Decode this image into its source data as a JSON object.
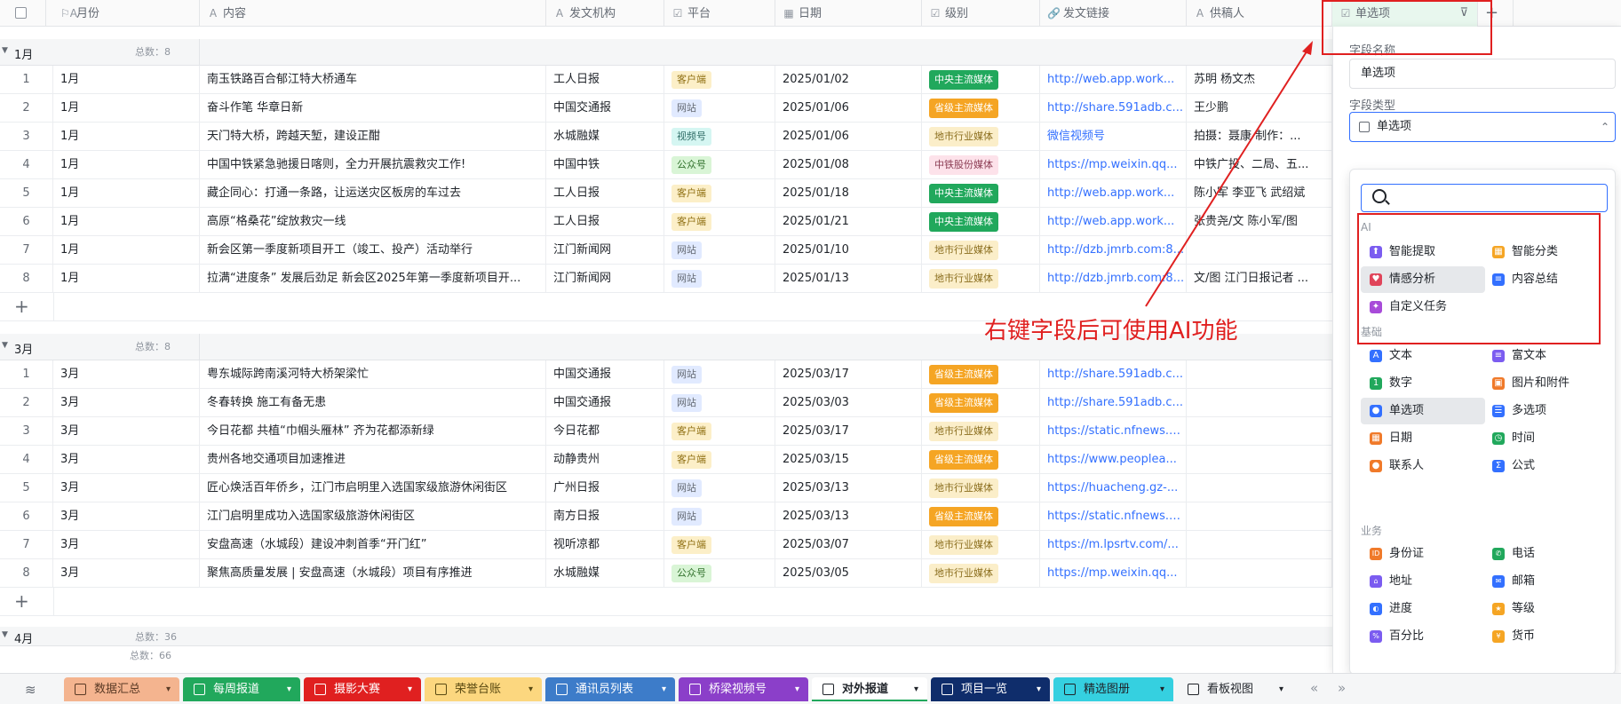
{
  "header": {
    "columns": [
      "月份",
      "内容",
      "发文机构",
      "平台",
      "日期",
      "级别",
      "发文链接",
      "供稿人",
      "单选项"
    ],
    "add": "+"
  },
  "groups": [
    {
      "name": "1月",
      "count": "总数：8",
      "rows": [
        [
          "1",
          "1月",
          "南玉铁路百合郁江特大桥通车",
          "工人日报",
          "客户端",
          "2025/01/02",
          "中央主流媒体",
          "http://web.app.work...",
          "苏明 杨文杰"
        ],
        [
          "2",
          "1月",
          "奋斗作笔 华章日新",
          "中国交通报",
          "网站",
          "2025/01/06",
          "省级主流媒体",
          "http://share.591adb.c...",
          "王少鹏"
        ],
        [
          "3",
          "1月",
          "天门特大桥，跨越天堑，建设正酣",
          "水城融媒",
          "视频号",
          "2025/01/06",
          "地市行业媒体",
          "微信视频号",
          "拍摄：聂康    制作：..."
        ],
        [
          "4",
          "1月",
          "中国中铁紧急驰援日喀则，全力开展抗震救灾工作!",
          "中国中铁",
          "公众号",
          "2025/01/08",
          "中铁股份媒体",
          "https://mp.weixin.qq...",
          "中铁广投、二局、五..."
        ],
        [
          "5",
          "1月",
          "藏企同心：打通一条路，让运送灾区板房的车过去",
          "工人日报",
          "客户端",
          "2025/01/18",
          "中央主流媒体",
          "http://web.app.work...",
          "陈小军 李亚飞 武绍斌"
        ],
        [
          "6",
          "1月",
          "高原“格桑花”绽放救灾一线",
          "工人日报",
          "客户端",
          "2025/01/21",
          "中央主流媒体",
          "http://web.app.work...",
          "张贵尧/文 陈小军/图"
        ],
        [
          "7",
          "1月",
          "新会区第一季度新项目开工（竣工、投产）活动举行",
          "江门新闻网",
          "网站",
          "2025/01/10",
          "地市行业媒体",
          "http://dzb.jmrb.com:8...",
          ""
        ],
        [
          "8",
          "1月",
          "拉满“进度条” 发展后劲足 新会区2025年第一季度新项目开...",
          "江门新闻网",
          "网站",
          "2025/01/13",
          "地市行业媒体",
          "http://dzb.jmrb.com:8...",
          "文/图 江门日报记者 ..."
        ]
      ]
    },
    {
      "name": "3月",
      "count": "总数：8",
      "rows": [
        [
          "1",
          "3月",
          "粤东城际跨南溪河特大桥架梁忙",
          "中国交通报",
          "网站",
          "2025/03/17",
          "省级主流媒体",
          "http://share.591adb.c...",
          ""
        ],
        [
          "2",
          "3月",
          "冬春转换 施工有备无患",
          "中国交通报",
          "网站",
          "2025/03/03",
          "省级主流媒体",
          "http://share.591adb.c...",
          ""
        ],
        [
          "3",
          "3月",
          "今日花都 共植“巾帼头雁林” 齐为花都添新绿",
          "今日花都",
          "客户端",
          "2025/03/17",
          "地市行业媒体",
          "https://static.nfnews.c...",
          ""
        ],
        [
          "4",
          "3月",
          " 贵州各地交通项目加速推进",
          "动静贵州",
          "客户端",
          "2025/03/15",
          "省级主流媒体",
          "https://www.peoplea...",
          ""
        ],
        [
          "5",
          "3月",
          "匠心焕活百年侨乡，江门市启明里入选国家级旅游休闲街区",
          "广州日报",
          "网站",
          "2025/03/13",
          "地市行业媒体",
          "https://huacheng.gz-...",
          ""
        ],
        [
          "6",
          "3月",
          "江门启明里成功入选国家级旅游休闲街区",
          "南方日报",
          "网站",
          "2025/03/13",
          "省级主流媒体",
          "https://static.nfnews.c...",
          ""
        ],
        [
          "7",
          "3月",
          "安盘高速（水城段）建设冲刺首季“开门红”",
          "视听凉都",
          "客户端",
          "2025/03/07",
          "地市行业媒体",
          "https://m.lpsrtv.com/...",
          ""
        ],
        [
          "8",
          "3月",
          "聚焦高质量发展 | 安盘高速（水城段）项目有序推进",
          "水城融媒",
          "公众号",
          "2025/03/05",
          "地市行业媒体",
          "https://mp.weixin.qq...",
          ""
        ]
      ]
    }
  ],
  "group3": {
    "name": "4月",
    "count": "总数：36"
  },
  "total": "总数：66",
  "panel": {
    "field_name_label": "字段名称",
    "field_name_value": "单选项",
    "field_type_label": "字段类型",
    "field_type_value": "单选项"
  },
  "dropdown": {
    "sections": {
      "ai": "AI",
      "basic": "基础",
      "business": "业务"
    },
    "ai_items": [
      "智能提取",
      "智能分类",
      "情感分析",
      "内容总结",
      "自定义任务"
    ],
    "basic_items": [
      "文本",
      "富文本",
      "数字",
      "图片和附件",
      "单选项",
      "多选项",
      "日期",
      "时间",
      "联系人",
      "公式"
    ],
    "business_items": [
      "身份证",
      "电话",
      "地址",
      "邮箱",
      "进度",
      "等级",
      "百分比",
      "货币"
    ]
  },
  "annotation": "右键字段后可使用AI功能",
  "tabs": [
    "数据汇总",
    "每周报道",
    "摄影大赛",
    "荣誉台账",
    "通讯员列表",
    "桥梁视频号",
    "对外报道",
    "项目一览",
    "精选图册",
    "看板视图"
  ],
  "colors": {
    "accent": "#3370ff",
    "red": "#e02020",
    "central": "#21a85c",
    "prov": "#f5a524"
  }
}
